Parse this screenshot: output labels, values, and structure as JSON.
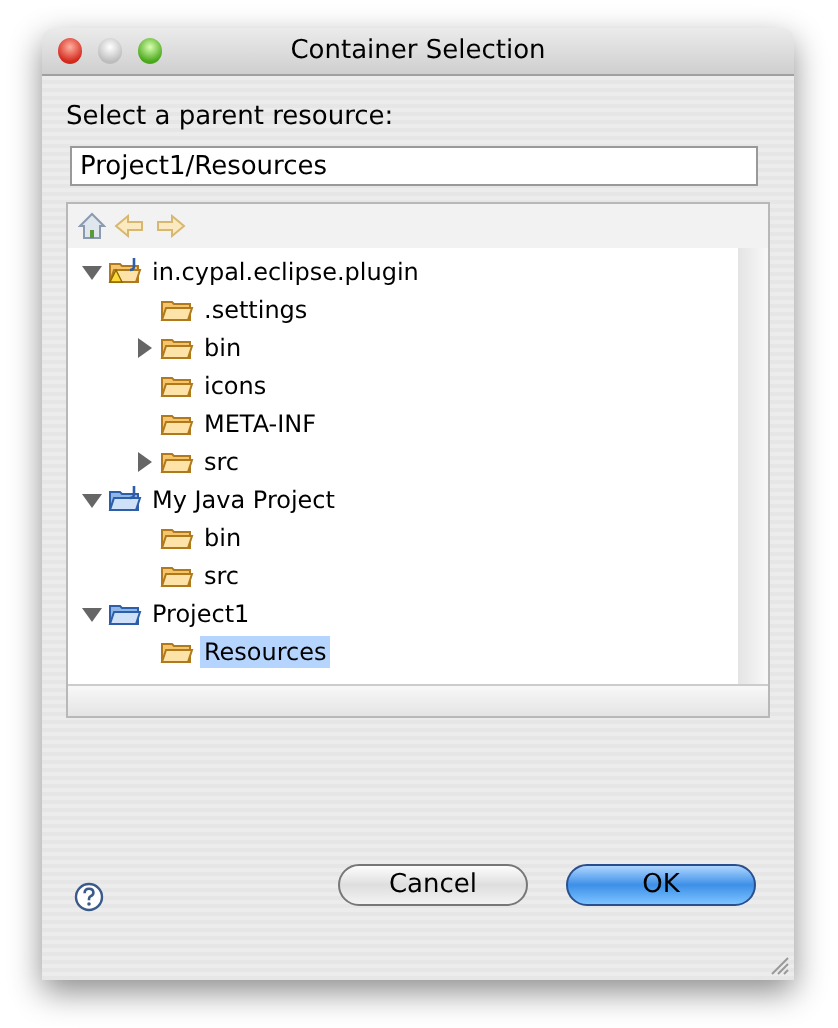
{
  "window": {
    "title": "Container Selection"
  },
  "prompt": "Select a parent resource:",
  "path_field": {
    "value": "Project1/Resources"
  },
  "tree": [
    {
      "label": "in.cypal.eclipse.plugin",
      "kind": "project-warning",
      "expandable": true,
      "expanded": true,
      "selected": false,
      "children": [
        {
          "label": ".settings",
          "kind": "folder",
          "expandable": false,
          "selected": false
        },
        {
          "label": "bin",
          "kind": "folder",
          "expandable": true,
          "expanded": false,
          "selected": false
        },
        {
          "label": "icons",
          "kind": "folder",
          "expandable": false,
          "selected": false
        },
        {
          "label": "META-INF",
          "kind": "folder",
          "expandable": false,
          "selected": false
        },
        {
          "label": "src",
          "kind": "folder",
          "expandable": true,
          "expanded": false,
          "selected": false
        }
      ]
    },
    {
      "label": "My Java Project",
      "kind": "project",
      "expandable": true,
      "expanded": true,
      "selected": false,
      "children": [
        {
          "label": "bin",
          "kind": "folder",
          "expandable": false,
          "selected": false
        },
        {
          "label": "src",
          "kind": "folder",
          "expandable": false,
          "selected": false
        }
      ]
    },
    {
      "label": "Project1",
      "kind": "open-folder",
      "expandable": true,
      "expanded": true,
      "selected": false,
      "children": [
        {
          "label": "Resources",
          "kind": "folder",
          "expandable": false,
          "selected": true
        }
      ]
    }
  ],
  "buttons": [
    {
      "label": "Cancel",
      "kind": "secondary"
    },
    {
      "label": "OK",
      "kind": "default"
    }
  ]
}
